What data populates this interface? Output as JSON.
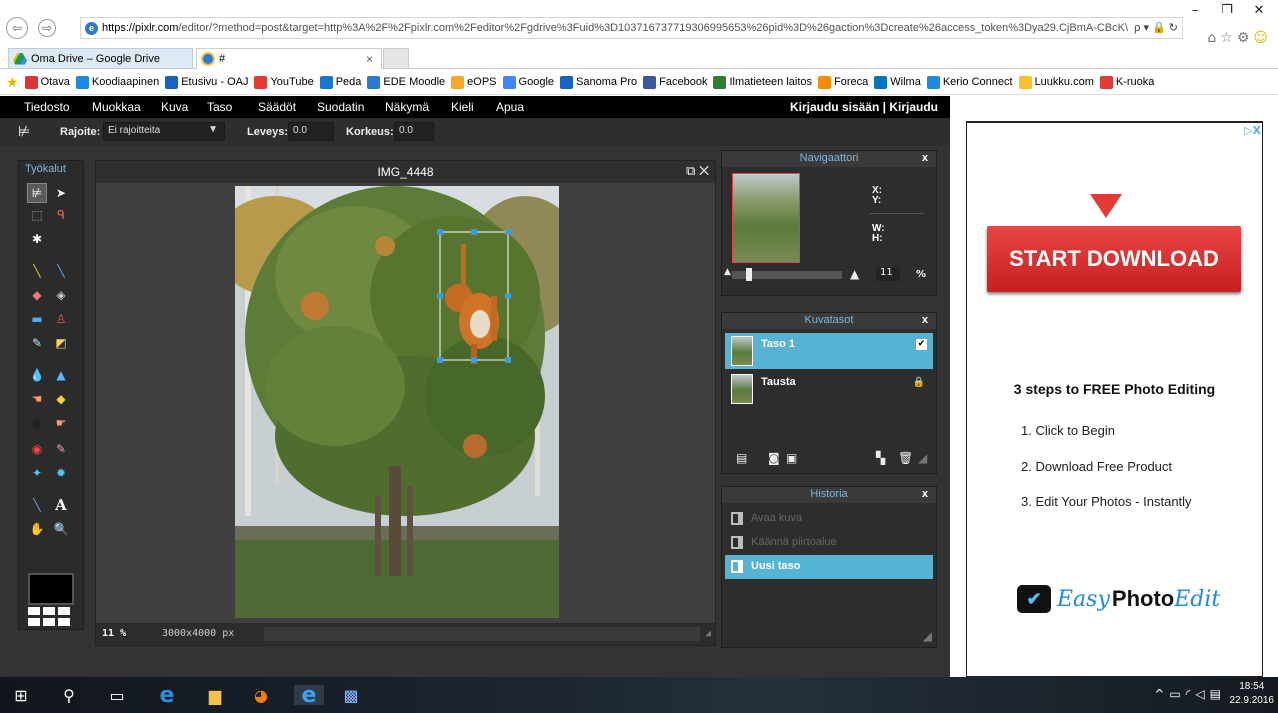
{
  "browser": {
    "url_host": "https://pixlr.com",
    "url_path": "/editor/?method=post&target=http%3A%2F%2Fpixlr.com%2Feditor%2Fgdrive%3Fuid%3D103716737719306995653%26pid%3D%26gaction%3Dcreate%26access_token%3Dya29.CjBmA-CBcK\\",
    "url_icons": "ρ ▾ 🔒 ↻",
    "tabs": [
      {
        "label": "Oma Drive – Google Drive"
      },
      {
        "label": "#"
      }
    ],
    "tab_close": "×",
    "favorites": [
      {
        "label": "Otava",
        "icon": "otava-icon",
        "color": "#d33"
      },
      {
        "label": "Koodiaapinen",
        "icon": "koodiaapinen-icon",
        "color": "#1e88e5"
      },
      {
        "label": "Etusivu - OAJ",
        "icon": "oaj-icon",
        "color": "#1565c0"
      },
      {
        "label": "YouTube",
        "icon": "youtube-icon",
        "color": "#e53935"
      },
      {
        "label": "Peda",
        "icon": "peda-icon",
        "color": "#1976d2"
      },
      {
        "label": "EDE Moodle",
        "icon": "ie-icon",
        "color": "#2b79d0"
      },
      {
        "label": "eOPS",
        "icon": "eops-icon",
        "color": "#f9a825"
      },
      {
        "label": "Google",
        "icon": "google-icon",
        "color": "#4285f4"
      },
      {
        "label": "Sanoma Pro",
        "icon": "sanoma-icon",
        "color": "#1565c0"
      },
      {
        "label": "Facebook",
        "icon": "facebook-icon",
        "color": "#3b5998"
      },
      {
        "label": "Ilmatieteen laitos",
        "icon": "fmi-icon",
        "color": "#2e7d32"
      },
      {
        "label": "Foreca",
        "icon": "foreca-icon",
        "color": "#fb8c00"
      },
      {
        "label": "Wilma",
        "icon": "wilma-icon",
        "color": "#0277bd"
      },
      {
        "label": "Kerio Connect",
        "icon": "kerio-icon",
        "color": "#1e88e5"
      },
      {
        "label": "Luukku.com",
        "icon": "luukku-icon",
        "color": "#fbc02d"
      },
      {
        "label": "K-ruoka",
        "icon": "kruoka-icon",
        "color": "#e53935"
      }
    ]
  },
  "menu": {
    "items": [
      "Tiedosto",
      "Muokkaa",
      "Kuva",
      "Taso",
      "Säädöt",
      "Suodatin",
      "Näkymä",
      "Kieli",
      "Apua"
    ],
    "login": "Kirjaudu sisään  |  Kirjaudu"
  },
  "options": {
    "constraint_label": "Rajoite:",
    "constraint_value": "Ei rajoitteita",
    "width_label": "Leveys:",
    "width_value": "0.0",
    "height_label": "Korkeus:",
    "height_value": "0.0"
  },
  "tools": {
    "title": "Työkalut"
  },
  "canvas": {
    "title": "IMG_4448",
    "zoom": "11",
    "zoom_unit": "%",
    "dimensions": "3000x4000 px"
  },
  "navigator": {
    "title": "Navigaattori",
    "x_label": "X:",
    "y_label": "Y:",
    "w_label": "W:",
    "h_label": "H:",
    "zoom": "11",
    "zoom_unit": "%"
  },
  "layers": {
    "title": "Kuvatasot",
    "items": [
      {
        "name": "Taso 1",
        "selected": true
      },
      {
        "name": "Tausta",
        "selected": false
      }
    ]
  },
  "history": {
    "title": "Historia",
    "items": [
      {
        "label": "Avaa kuva"
      },
      {
        "label": "Käännä piirtoalue"
      },
      {
        "label": "Uusi taso"
      }
    ]
  },
  "ad": {
    "badge": "▷X",
    "button": "START DOWNLOAD",
    "headline": "3 steps to FREE Photo Editing",
    "steps": [
      "1. Click to Begin",
      "2. Download Free Product",
      "3. Edit Your Photos - Instantly"
    ],
    "logo_easy": "Easy",
    "logo_photo": "Photo",
    "logo_edit": "Edit"
  },
  "taskbar": {
    "time": "18:54",
    "date": "22.9.2016"
  }
}
